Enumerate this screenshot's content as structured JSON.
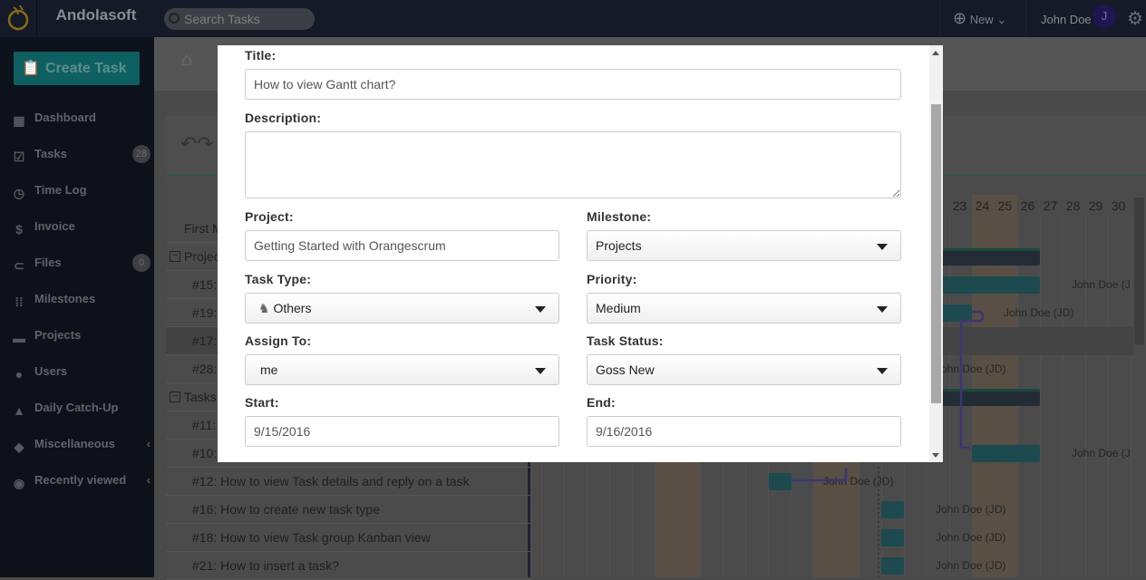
{
  "app": {
    "brand": "Andolasoft",
    "search_placeholder": "Search Tasks",
    "new_label": "New",
    "user_name": "John Doe",
    "avatar_initial": "J"
  },
  "sidebar": {
    "create_task": "Create Task",
    "items": [
      {
        "label": "Dashboard",
        "icon": "dashboard-icon"
      },
      {
        "label": "Tasks",
        "icon": "tasks-icon",
        "badge": "28"
      },
      {
        "label": "Time Log",
        "icon": "clock-icon"
      },
      {
        "label": "Invoice",
        "icon": "invoice-icon"
      },
      {
        "label": "Files",
        "icon": "paperclip-icon",
        "badge": "0"
      },
      {
        "label": "Milestones",
        "icon": "milestones-icon"
      },
      {
        "label": "Projects",
        "icon": "briefcase-icon"
      },
      {
        "label": "Users",
        "icon": "user-icon"
      },
      {
        "label": "Daily Catch-Up",
        "icon": "bell-icon"
      },
      {
        "label": "Miscellaneous",
        "icon": "layers-icon",
        "chevron": true
      },
      {
        "label": "Recently viewed",
        "icon": "eye-icon",
        "chevron": true
      }
    ]
  },
  "gantt": {
    "rows": [
      {
        "text": "First M",
        "indent": 1
      },
      {
        "text": "Projec",
        "group": true
      },
      {
        "text": "#15:",
        "indent": 2
      },
      {
        "text": "#19:",
        "indent": 2
      },
      {
        "text": "#17:",
        "indent": 2,
        "highlight": true
      },
      {
        "text": "#28:",
        "indent": 2
      },
      {
        "text": "Tasks",
        "group": true
      },
      {
        "text": "#11:",
        "indent": 2
      },
      {
        "text": "#10:",
        "indent": 2
      },
      {
        "text": "#12: How to view Task details and reply on a task",
        "indent": 2
      },
      {
        "text": "#16: How to create new task type",
        "indent": 2
      },
      {
        "text": "#18: How to view Task group Kanban view",
        "indent": 2
      },
      {
        "text": "#21: How to insert a task?",
        "indent": 2
      }
    ],
    "days": [
      "23",
      "24",
      "25",
      "26",
      "27",
      "28",
      "29",
      "30"
    ],
    "assignee_label": "John Doe (JD)",
    "assignee_label_cut": "John Doe (J"
  },
  "modal": {
    "title_label": "Title:",
    "title_value": "How to view Gantt chart?",
    "description_label": "Description:",
    "description_value": "",
    "project_label": "Project:",
    "project_value": "Getting Started with Orangescrum",
    "milestone_label": "Milestone:",
    "milestone_value": "Projects",
    "task_type_label": "Task Type:",
    "task_type_value": "Others",
    "priority_label": "Priority:",
    "priority_value": "Medium",
    "assign_label": "Assign To:",
    "assign_value": "me",
    "status_label": "Task Status:",
    "status_value": "Goss New",
    "start_label": "Start:",
    "start_value": "9/15/2016",
    "end_label": "End:",
    "end_value": "9/16/2016"
  },
  "colors": {
    "accent": "#0e5f61",
    "avatar": "#1f1550",
    "bar_teal": "#1d4a4e"
  }
}
